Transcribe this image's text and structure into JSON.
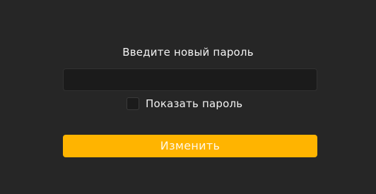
{
  "form": {
    "title": "Введите новый пароль",
    "password_value": "",
    "password_placeholder": "",
    "show_password_label": "Показать пароль",
    "show_password_checked": false,
    "submit_label": "Изменить"
  },
  "colors": {
    "background": "#262626",
    "input_background": "#1b1b1b",
    "accent": "#ffb400",
    "text": "#f2f2f2"
  }
}
